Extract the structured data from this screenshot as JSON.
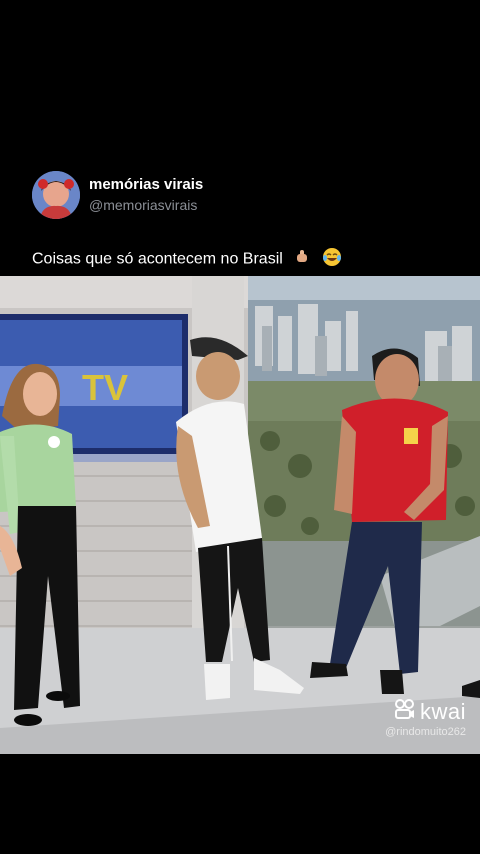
{
  "post": {
    "author_name": "memórias virais",
    "author_handle": "@memoriasvirais",
    "caption": "Coisas que só acontecem no Brasil",
    "caption_emojis": [
      "pointing-down-hand-emoji",
      "laughing-tears-emoji"
    ]
  },
  "video": {
    "studio_logo": "TV",
    "watermark_brand": "kwai",
    "watermark_user": "@rindomuito262"
  },
  "colors": {
    "background": "#000000",
    "handle_gray": "#8b8f96",
    "polo_red": "#d01f2a"
  }
}
